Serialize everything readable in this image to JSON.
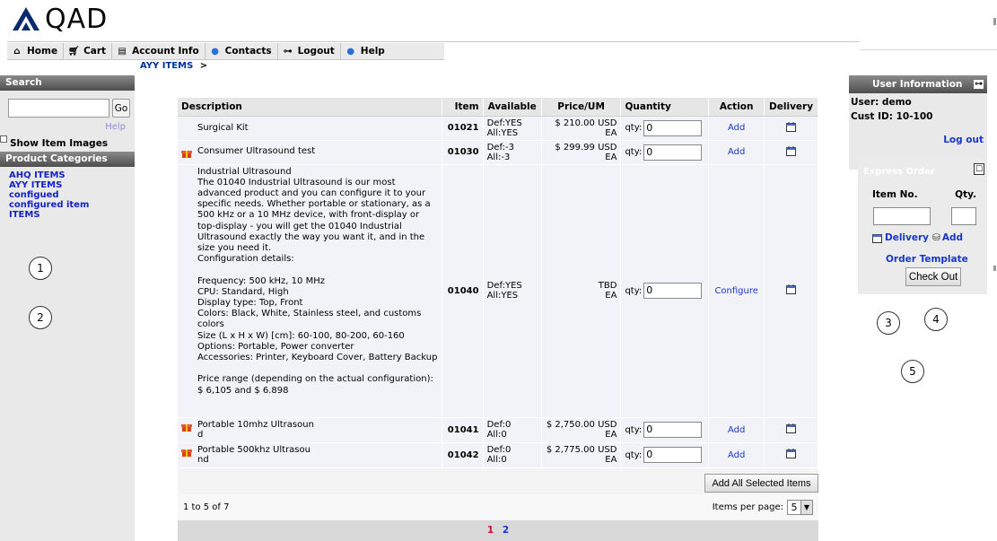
{
  "brand": {
    "logo_text": "QAD"
  },
  "nav": [
    {
      "label": "Home",
      "icon": "home-icon"
    },
    {
      "label": "Cart",
      "icon": "cart-icon"
    },
    {
      "label": "Account Info",
      "icon": "account-icon"
    },
    {
      "label": "Contacts",
      "icon": "info-icon"
    },
    {
      "label": "Logout",
      "icon": "key-icon"
    },
    {
      "label": "Help",
      "icon": "help-icon"
    }
  ],
  "breadcrumb": {
    "current": "AYY ITEMS",
    "separator": ">"
  },
  "sidebar": {
    "search_title": "Search",
    "search_value": "",
    "go_label": "Go",
    "help_label": "Help",
    "show_images_label": "Show Item Images",
    "categories_title": "Product Categories",
    "categories": [
      "AHQ ITEMS",
      "AYY ITEMS",
      "configued",
      "configured item",
      "ITEMS"
    ]
  },
  "annotations": [
    "1",
    "2",
    "3",
    "4",
    "5"
  ],
  "table": {
    "headers": {
      "description": "Description",
      "item": "Item",
      "available": "Available",
      "price": "Price/UM",
      "quantity": "Quantity",
      "action": "Action",
      "delivery": "Delivery"
    },
    "rows": [
      {
        "description": "Surgical Kit",
        "item": "01021",
        "avail1": "Def:YES",
        "avail2": "All:YES",
        "price1": "$ 210.00 USD",
        "price2": "EA",
        "qty_label": "qty:",
        "qty": "0",
        "action": "Add"
      },
      {
        "description": "Consumer Ultrasound test",
        "item": "01030",
        "avail1": "Def:-3",
        "avail2": "All:-3",
        "price1": "$ 299.99 USD",
        "price2": "EA",
        "qty_label": "qty:",
        "qty": "0",
        "action": "Add"
      },
      {
        "description_lines": [
          "Industrial Ultrasound",
          "The 01040 Industrial Ultrasound is our most advanced product and you can configure it to your specific needs. Whether portable or stationary, as a 500 kHz or a 10 MHz device, with front-display or top-display - you will get the 01040 Industrial Ultrasound exactly the way you want it, and in the size you need it.",
          "Configuration details:",
          "",
          "Frequency: 500 kHz, 10 MHz",
          "CPU: Standard, High",
          "Display type: Top, Front",
          "Colors: Black, White, Stainless steel, and customs colors",
          "Size (L x H x W) [cm]: 60-100, 80-200, 60-160",
          "Options: Portable, Power converter",
          "Accessories: Printer, Keyboard Cover, Battery Backup",
          "",
          "Price range (depending on the actual configuration): $ 6,105 and $ 6.898"
        ],
        "item": "01040",
        "avail1": "Def:YES",
        "avail2": "All:YES",
        "price1": "TBD",
        "price2": "EA",
        "qty_label": "qty:",
        "qty": "0",
        "action": "Configure"
      },
      {
        "description": "Portable 10mhz Ultrasoun",
        "description2": "d",
        "item": "01041",
        "avail1": "Def:0",
        "avail2": "All:0",
        "price1": "$ 2,750.00 USD",
        "price2": "EA",
        "qty_label": "qty:",
        "qty": "0",
        "action": "Add"
      },
      {
        "description": "Portable 500khz Ultrasou",
        "description2": "nd",
        "item": "01042",
        "avail1": "Def:0",
        "avail2": "All:0",
        "price1": "$ 2,775.00 USD",
        "price2": "EA",
        "qty_label": "qty:",
        "qty": "0",
        "action": "Add"
      }
    ],
    "add_all_label": "Add All Selected Items",
    "range_text": "1 to 5 of 7",
    "per_page_label": "Items per page:",
    "per_page_value": "5",
    "pages": [
      "1",
      "2"
    ]
  },
  "user": {
    "title": "User Information",
    "user_line": "User: demo",
    "cust_line": "Cust ID: 10-100",
    "logout": "Log out"
  },
  "express": {
    "title": "Express Order",
    "item_label": "Item No.",
    "qty_label": "Qty.",
    "delivery": "Delivery",
    "add": "Add",
    "order_template": "Order Template",
    "checkout": "Check Out"
  },
  "colors": {
    "link": "#1a36c9",
    "header_dark": "#4e4e4e",
    "page_current": "#c8102e"
  }
}
